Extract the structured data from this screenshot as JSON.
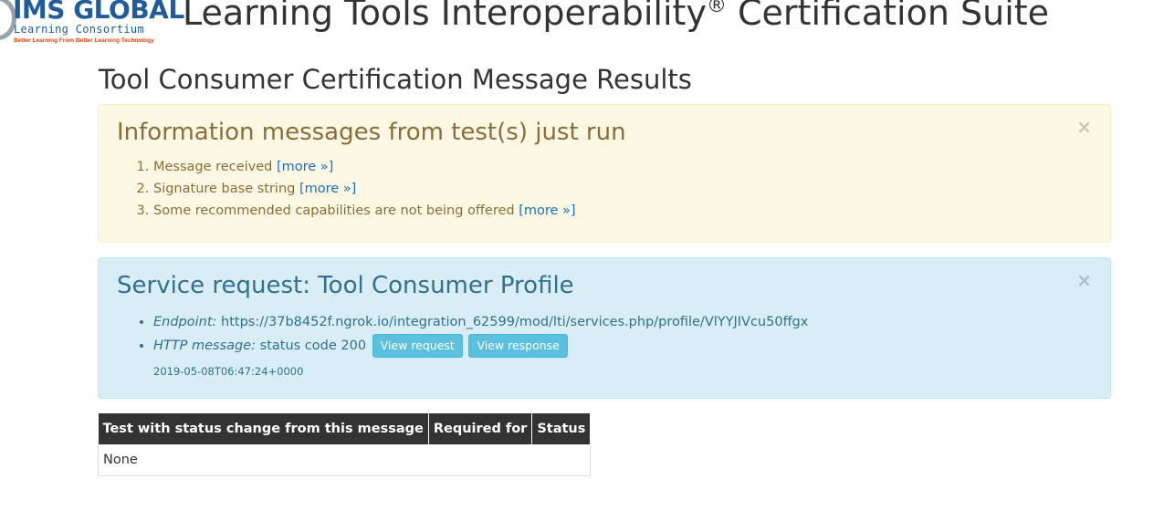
{
  "header": {
    "logo": {
      "main_text": "IMS GLOBAL",
      "sub_text": "Learning Consortium",
      "tagline": "Better Learning From Better Learning Technology"
    },
    "title_prefix": "Learning Tools Interoperability",
    "title_mark": "®",
    "title_suffix": " Certification Suite"
  },
  "page_title": "Tool Consumer Certification Message Results",
  "info_alert": {
    "heading": "Information messages from test(s) just run",
    "close_glyph": "×",
    "messages": [
      {
        "text": "Message received ",
        "link": "[more »]"
      },
      {
        "text": "Signature base string ",
        "link": "[more »]"
      },
      {
        "text": "Some recommended capabilities are not being offered ",
        "link": "[more »]"
      }
    ]
  },
  "service_alert": {
    "heading": "Service request: Tool Consumer Profile",
    "close_glyph": "×",
    "endpoint_label": "Endpoint:",
    "endpoint_value": " https://37b8452f.ngrok.io/integration_62599/mod/lti/services.php/profile/VlYYJIVcu50ffgx",
    "http_label": "HTTP message:",
    "http_value": " status code 200 ",
    "view_request_label": "View request",
    "view_response_label": "View response",
    "timestamp": "2019-05-08T06:47:24+0000"
  },
  "results_table": {
    "headers": [
      "Test with status change from this message",
      "Required for",
      "Status"
    ],
    "rows": [
      [
        "None"
      ]
    ]
  },
  "colors": {
    "warning_bg": "#fcf8e3",
    "warning_text": "#8a6d3b",
    "info_bg": "#d9edf7",
    "info_text": "#31708f",
    "button_info": "#5bc0de",
    "link": "#1a6fc0",
    "table_header_bg": "#333333"
  }
}
